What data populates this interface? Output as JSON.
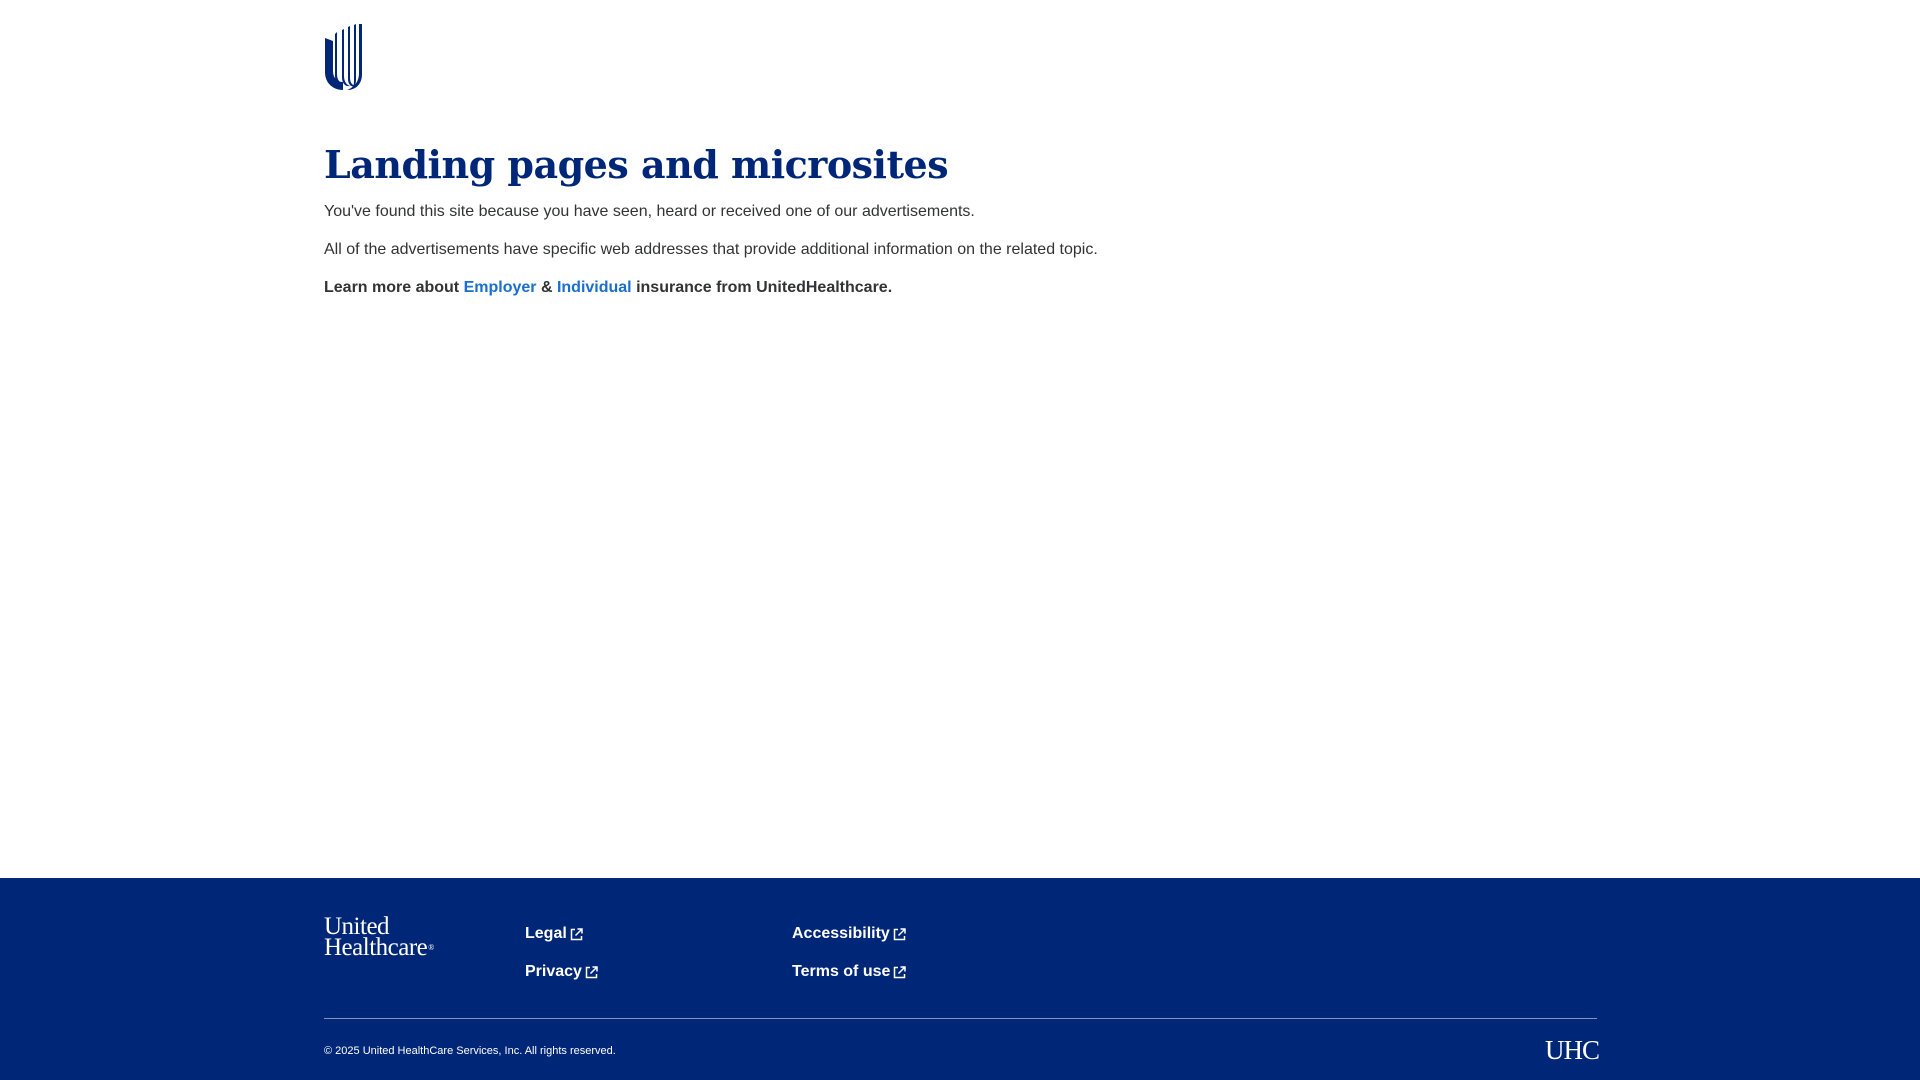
{
  "header": {
    "logo_icon": "uhc-u-logo-icon"
  },
  "main": {
    "title": "Landing pages and microsites",
    "para1": "You've found this site because you have seen, heard or received one of our advertisements.",
    "para2": "All of the advertisements have specific web addresses that provide additional information on the related topic.",
    "learn": {
      "prefix": "Learn more about ",
      "employer_link": "Employer",
      "amp": " & ",
      "individual_link": "Individual",
      "suffix": " insurance from UnitedHealthcare."
    }
  },
  "footer": {
    "brand_line1": "United",
    "brand_line2": "Healthcare",
    "brand_reg": "®",
    "links": {
      "legal": "Legal",
      "privacy": "Privacy",
      "accessibility": "Accessibility",
      "terms": "Terms of use"
    },
    "link_icon": "external-link-icon",
    "copyright": "© 2025 United HealthCare Services, Inc. All rights reserved.",
    "uhc_mark": "UHC"
  },
  "colors": {
    "brand_navy": "#002677",
    "link_blue": "#196ecf",
    "body_text": "#323334",
    "background": "#ffffff"
  }
}
